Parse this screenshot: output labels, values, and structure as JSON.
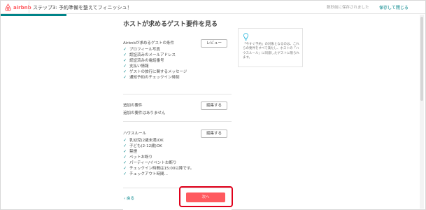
{
  "header": {
    "logo_text": "airbnb",
    "step_title": "ステップ3: 予約準備を整えてフィニッシュ！",
    "saved_status": "数秒前に保存されました",
    "save_exit_label": "保存して閉じる",
    "accent_color": "#008489",
    "brand_color": "#ff5a5f"
  },
  "main": {
    "title": "ホストが求めるゲスト要件を見る",
    "airbnb_requirements": {
      "label": "Airbnbが求めるゲストの条件",
      "button": "レビュー",
      "items": [
        "プロフィール写真",
        "認証済みのメールアドレス",
        "認証済みの電話番号",
        "支払い情報",
        "ゲストの旅行に関するメッセージ",
        "通知予約のチェックイン時刻"
      ]
    },
    "additional_requirements": {
      "label": "追加の要件",
      "button": "編集する",
      "value": "追加の要件はありません"
    },
    "house_rules": {
      "label": "ハウスルール",
      "button": "編集する",
      "items": [
        "乳幼児(2歳未満)OK",
        "子ども(2-12歳)OK",
        "禁煙",
        "ペットお断り",
        "パーティー/イベントお断り",
        "チェックイン時間は15:00以降です。",
        "チェックアウト時間…"
      ]
    }
  },
  "tip": {
    "icon": "lightbulb-icon",
    "text": "「今すぐ予約」の対象となるのは、これらの要件をすべて満たし、ホストの「ハウスルール」に同意したゲストに限られます。"
  },
  "footer": {
    "back_label": "‹ 戻る",
    "next_label": "次へ"
  }
}
